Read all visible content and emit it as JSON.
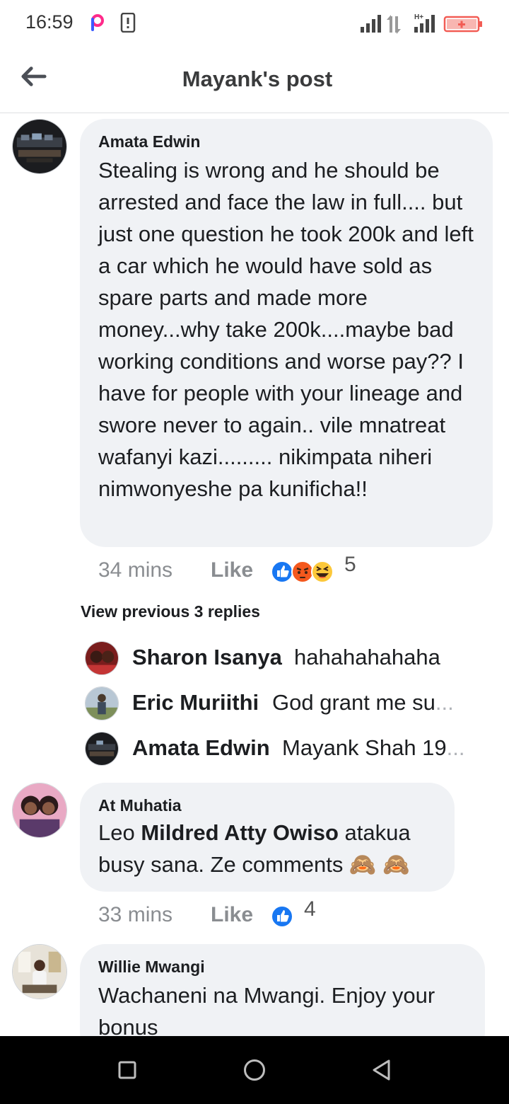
{
  "status_bar": {
    "time": "16:59",
    "icons": [
      "picsart-app-icon",
      "phone-icon",
      "signal-icon",
      "data-arrows-icon",
      "h-plus-signal-icon",
      "battery-low-icon"
    ]
  },
  "header": {
    "title": "Mayank's post",
    "back_icon": "back-arrow-icon"
  },
  "colors": {
    "like_blue": "#1877f2",
    "bubble_bg": "#f0f2f5",
    "muted_text": "#8a8d91",
    "battery_red": "#f25c54"
  },
  "comments": [
    {
      "author": "Amata Edwin",
      "text": "Stealing is wrong and he should be arrested and face the law in full.... but just one question he took 200k and left a car which he would have sold as spare parts and made more money...why take 200k....maybe bad working conditions and worse pay?? I have for people with your lineage and swore never to again.. vile mnatreat wafanyi kazi......... nikimpata niheri nimwonyeshe pa kunificha!!",
      "time": "34 mins",
      "like_label": "Like",
      "reactions": [
        "like",
        "angry",
        "haha"
      ],
      "reaction_count": "5"
    },
    {
      "author": "At Muhatia",
      "text_before": "Leo ",
      "mention": "Mildred Atty Owiso",
      "text_after": " atakua busy sana. Ze comments 🙈 🙈",
      "time": "33 mins",
      "like_label": "Like",
      "reactions": [
        "like"
      ],
      "reaction_count": "4"
    },
    {
      "author": "Willie Mwangi",
      "text": "Wachaneni na Mwangi.  Enjoy your bonus"
    }
  ],
  "replies_section": {
    "view_previous": "View previous 3 replies",
    "replies": [
      {
        "author": "Sharon Isanya",
        "text": "hahahahahaha"
      },
      {
        "author": "Eric Muriithi",
        "text": "God grant me su",
        "ellipsis": "..."
      },
      {
        "author": "Amata Edwin",
        "text": "Mayank Shah 19",
        "ellipsis": "..."
      }
    ]
  },
  "nav_bar": {
    "buttons": [
      "recents-square-icon",
      "home-circle-icon",
      "back-triangle-icon"
    ]
  }
}
